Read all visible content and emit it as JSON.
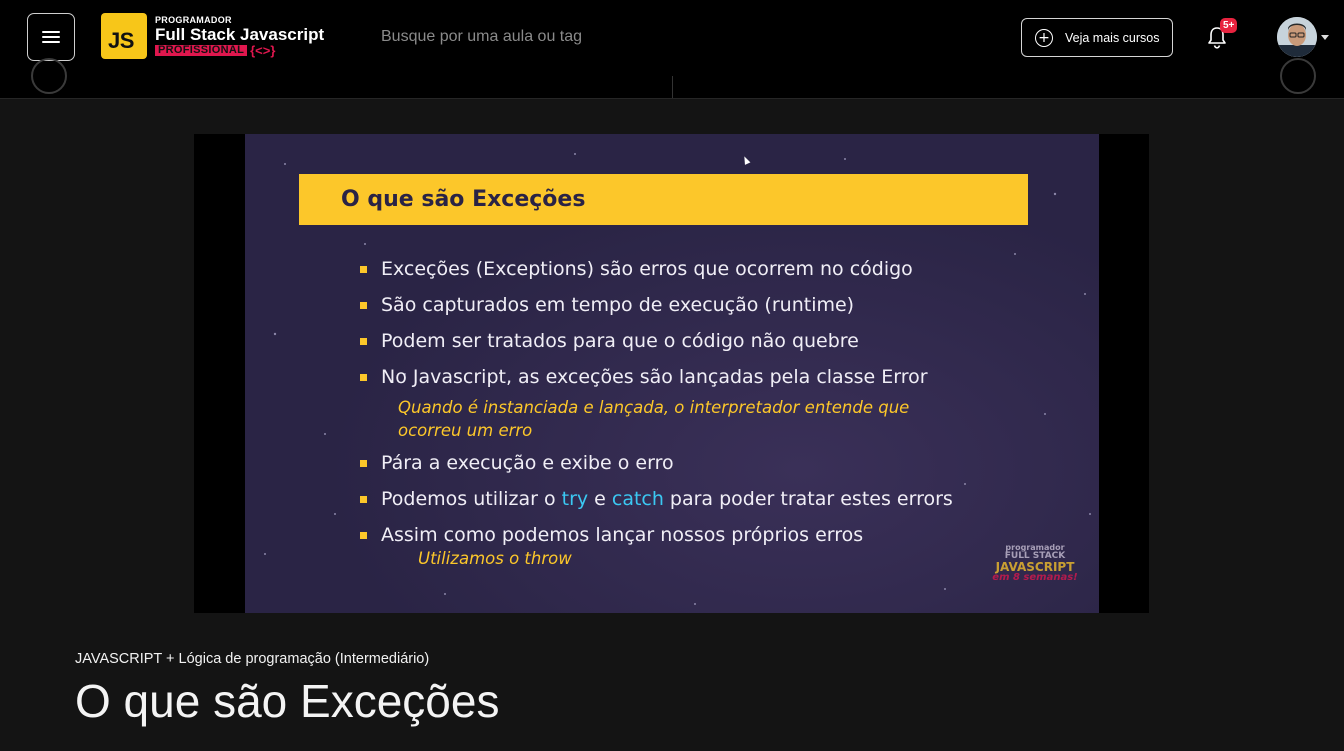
{
  "header": {
    "menu_icon": "hamburger-menu-icon",
    "logo": {
      "badge": "JS",
      "line1": "PROGRAMADOR",
      "line2": "Full Stack Javascript",
      "line3": "PROFISSIONAL",
      "brace": "{<>}"
    },
    "search_placeholder": "Busque por uma aula ou tag",
    "courses_button_label": "Veja mais cursos",
    "courses_button_icon": "plus-circle-icon",
    "notifications_icon": "bell-icon",
    "notifications_badge": "5+",
    "avatar": "user-avatar",
    "avatar_menu_icon": "caret-down-icon"
  },
  "video": {
    "slide_title": "O que são Exceções",
    "bullets": [
      {
        "text": "Exceções (Exceptions) são erros que ocorrem no código"
      },
      {
        "text": "São capturados em tempo de execução (runtime)"
      },
      {
        "text": "Podem ser tratados para que o código não quebre"
      },
      {
        "text": "No Javascript, as exceções são lançadas pela classe Error"
      },
      {
        "text": "Pára a execução e exibe o erro"
      },
      {
        "pre": "Podemos utilizar o ",
        "kw1": "try",
        "mid": " e ",
        "kw2": "catch",
        "post": " para poder tratar estes errors"
      },
      {
        "text": "Assim como podemos lançar nossos próprios erros"
      }
    ],
    "notes": {
      "error_line1": "Quando é instanciada e lançada, o interpretador entende que",
      "error_line2": "ocorreu um erro",
      "throw": "Utilizamos o throw"
    },
    "watermark": {
      "line1": "programador",
      "line2": "FULL STACK",
      "line3": "JAVASCRIPT",
      "line4": "em 8 semanas!"
    }
  },
  "lesson": {
    "course_title": "JAVASCRIPT + Lógica de programação (Intermediário)",
    "title": "O que são Exceções"
  },
  "colors": {
    "slide_bg": "#2a2445",
    "accent_yellow": "#fcc72a",
    "keyword_blue": "#3bc8f2",
    "badge_red": "#e8233f",
    "logo_pink": "#e0174e"
  }
}
